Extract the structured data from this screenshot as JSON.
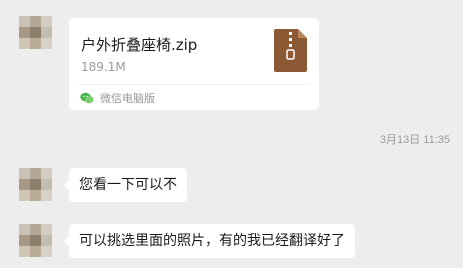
{
  "messages": {
    "file": {
      "name": "户外折叠座椅.zip",
      "size": "189.1M",
      "source": "微信电脑版",
      "icon": "zip-file-icon",
      "icon_color": "#8b5a34"
    },
    "timestamp": "3月13日 11:35",
    "text1": "您看一下可以不",
    "text2": "可以挑选里面的照片，有的我已经翻译好了"
  }
}
